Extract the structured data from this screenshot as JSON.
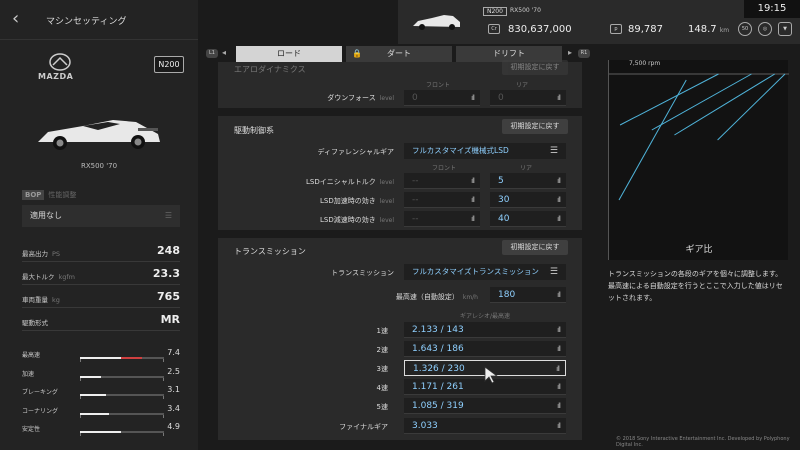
{
  "header": {
    "back_label": "‹",
    "title": "マシンセッティング",
    "clock": "19:15",
    "badge": "N200",
    "car_name": "RX500 '70",
    "credits": "830,637,000",
    "points": "89,787",
    "km": "148.7",
    "km_unit": "km",
    "level": "50"
  },
  "car": {
    "brand": "mazda",
    "class_badge": "N200",
    "name": "RX500 '70",
    "pp_label": "BOP",
    "pp_text": "性能調整",
    "tune_setting": "適用なし"
  },
  "specs": [
    {
      "label": "最高出力",
      "unit": "PS",
      "value": "248"
    },
    {
      "label": "最大トルク",
      "unit": "kgfm",
      "value": "23.3"
    },
    {
      "label": "車両重量",
      "unit": "kg",
      "value": "765"
    },
    {
      "label": "駆動形式",
      "unit": "",
      "value": "MR"
    }
  ],
  "ratings": [
    {
      "label": "最高速",
      "value": "7.4",
      "level": 0.74,
      "accent": "#d04040"
    },
    {
      "label": "加速",
      "value": "2.5",
      "level": 0.25
    },
    {
      "label": "ブレーキング",
      "value": "3.1",
      "level": 0.31
    },
    {
      "label": "コーナリング",
      "value": "3.4",
      "level": 0.34
    },
    {
      "label": "安定性",
      "value": "4.9",
      "level": 0.49
    }
  ],
  "tabs": {
    "l1": "L1",
    "r1": "R1",
    "road": "ロード",
    "dirt": "ダート",
    "drift": "ドリフト"
  },
  "aero": {
    "title": "エアロダイナミクス",
    "reset": "初期設定に戻す",
    "col_front": "フロント",
    "col_rear": "リア",
    "downforce_label": "ダウンフォース",
    "downforce_unit": "level",
    "front": "0",
    "rear": "0"
  },
  "drivetrain": {
    "title": "駆動制御系",
    "reset": "初期設定に戻す",
    "diff_label": "ディファレンシャルギア",
    "diff_value": "フルカスタマイズ機械式LSD",
    "col_front": "フロント",
    "col_rear": "リア",
    "rows": [
      {
        "label": "LSDイニシャルトルク",
        "unit": "level",
        "front": "--",
        "rear": "5"
      },
      {
        "label": "LSD加速時の効き",
        "unit": "level",
        "front": "--",
        "rear": "30"
      },
      {
        "label": "LSD減速時の効き",
        "unit": "level",
        "front": "--",
        "rear": "40"
      }
    ]
  },
  "transmission": {
    "title": "トランスミッション",
    "reset": "初期設定に戻す",
    "trans_label": "トランスミッション",
    "trans_value": "フルカスタマイズトランスミッション",
    "topspeed_label": "最高速（自動設定）",
    "topspeed_unit": "km/h",
    "topspeed": "180",
    "ratio_head": "ギアレシオ/最高速",
    "gears": [
      {
        "label": "1速",
        "value": "2.133 / 143"
      },
      {
        "label": "2速",
        "value": "1.643 / 186"
      },
      {
        "label": "3速",
        "value": "1.326 / 230"
      },
      {
        "label": "4速",
        "value": "1.171 / 261"
      },
      {
        "label": "5速",
        "value": "1.085 / 319"
      }
    ],
    "final_label": "ファイナルギア",
    "final": "3.033"
  },
  "graph": {
    "rpm_label": "7,500 rpm",
    "line_color": "#4fb3d9",
    "title": "ギア比",
    "description": "トランスミッションの各段のギアを個々に調整します。最高速による自動設定を行うとここで入力した値はリセットされます。"
  },
  "footer": {
    "copyright": "© 2018 Sony Interactive Entertainment Inc. Developed by Polyphony Digital Inc."
  }
}
